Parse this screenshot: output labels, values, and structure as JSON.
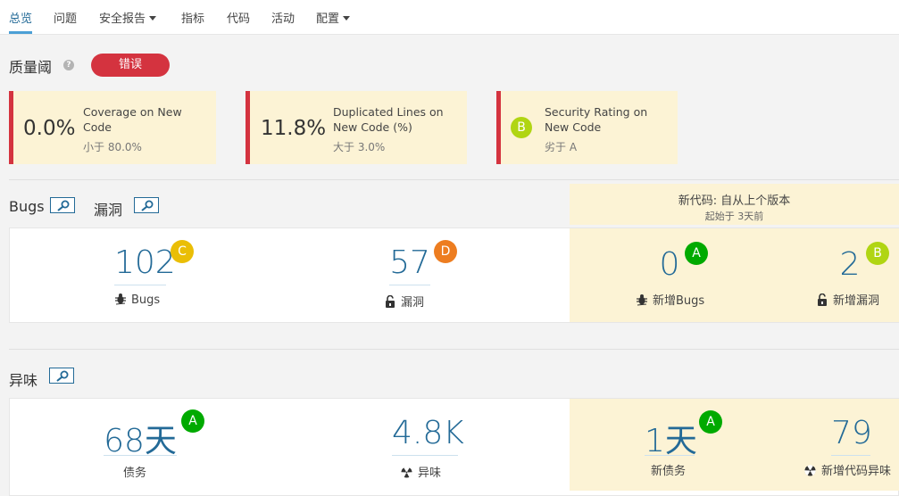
{
  "nav": {
    "items": [
      {
        "label": "总览"
      },
      {
        "label": "问题"
      },
      {
        "label": "安全报告"
      },
      {
        "label": "指标"
      },
      {
        "label": "代码"
      },
      {
        "label": "活动"
      },
      {
        "label": "配置"
      }
    ]
  },
  "quality_gate": {
    "title": "质量阈",
    "help_icon": "?",
    "status": "错误",
    "status_color": "#d4333f",
    "conditions": [
      {
        "value": "0.0%",
        "metric": "Coverage on New Code",
        "threshold": "小于 80.0%"
      },
      {
        "value": "11.8%",
        "metric": "Duplicated Lines on New Code (%)",
        "threshold": "大于 3.0%"
      },
      {
        "rating": "B",
        "metric": "Security Rating on New Code",
        "threshold": "劣于 A"
      }
    ]
  },
  "bugs_section": {
    "bugs_title": "Bugs",
    "vuln_title": "漏洞",
    "leak_title": "新代码: 自从上个版本",
    "leak_since": "起始于 3天前",
    "bugs": {
      "value": "102",
      "rating": "C",
      "label": "Bugs"
    },
    "vulnerabilities": {
      "value": "57",
      "rating": "D",
      "label": "漏洞"
    },
    "new_bugs": {
      "value": "0",
      "rating": "A",
      "label": "新增Bugs"
    },
    "new_vulnerabilities": {
      "value": "2",
      "rating": "B",
      "label": "新增漏洞"
    }
  },
  "smells_section": {
    "title": "异味",
    "debt": {
      "value": "68天",
      "rating": "A",
      "label": "债务"
    },
    "smells": {
      "value": "4.8K",
      "label": "异味"
    },
    "new_debt": {
      "value": "1天",
      "rating": "A",
      "label": "新债务"
    },
    "new_smells": {
      "value": "79",
      "label": "新增代码异味"
    }
  },
  "colors": {
    "link": "#236a97",
    "leak_bg": "#fcf3d5",
    "rating_A": "#00aa00",
    "rating_B": "#b0d513",
    "rating_C": "#eabe06",
    "rating_D": "#ed7d20"
  }
}
